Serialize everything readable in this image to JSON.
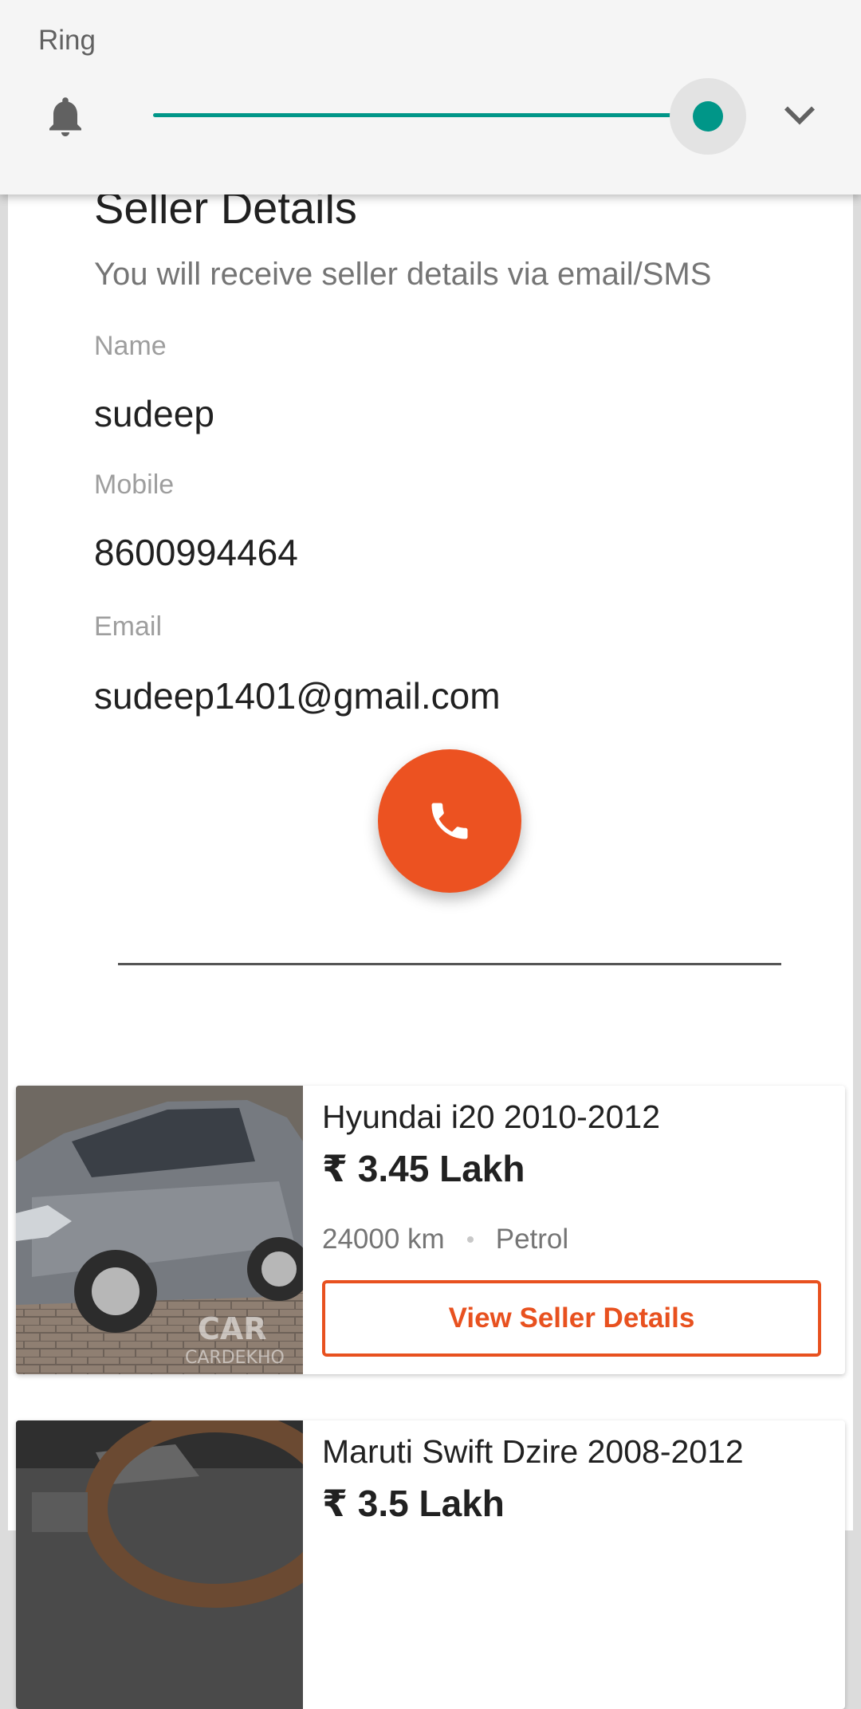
{
  "volume_panel": {
    "label": "Ring",
    "level_percent": 100,
    "accent_color": "#009688",
    "icons": [
      "bell-icon",
      "chevron-down-icon"
    ]
  },
  "seller_details": {
    "title": "Seller Details",
    "subtitle": "You will receive seller details via email/SMS",
    "name_label": "Name",
    "name_value": "sudeep",
    "mobile_label": "Mobile",
    "mobile_value": "8600994464",
    "email_label": "Email",
    "email_value": "sudeep1401@gmail.com",
    "call_button_icon": "phone-icon",
    "call_button_color": "#ec5221"
  },
  "listings": [
    {
      "title": "Hyundai i20 2010-2012",
      "price": "₹ 3.45 Lakh",
      "km": "24000 km",
      "fuel": "Petrol",
      "button_label": "View Seller Details",
      "image_watermark": "CARDEKHO"
    },
    {
      "title": "Maruti Swift Dzire 2008-2012",
      "price": "₹ 3.5 Lakh"
    }
  ],
  "brand_color": "#e8511f"
}
